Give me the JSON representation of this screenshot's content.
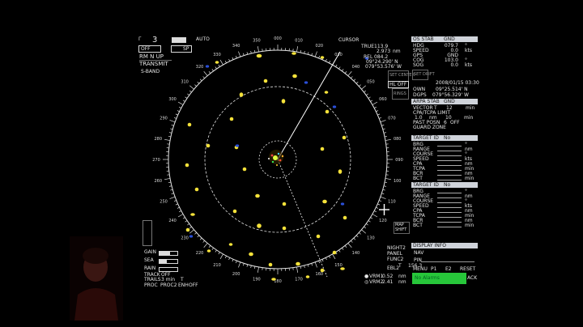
{
  "top_left": {
    "range_value": "3",
    "mode_off": "OFF",
    "sp_label": "SP",
    "auto_label": "AUTO",
    "orientation": "RM N UP",
    "transmit": "TRANSMIT",
    "band": "S-BAND"
  },
  "cursor": {
    "label": "CURSOR",
    "true_label": "TRUE",
    "true_value": "113.9",
    "rng_value": "2.973",
    "rng_unit": "nm",
    "rel_label": "REL",
    "rel_value": "084.2",
    "lat": "09°24.290' N",
    "lon": "079°53.576' W"
  },
  "side_buttons": {
    "set_center": "SET CENTER",
    "hl_off": "HL OFF",
    "rings": "RINGS"
  },
  "ownship": {
    "header_left": "OS STAB",
    "header_right": "GND",
    "rows": [
      {
        "key": "HDG",
        "val": "079.7",
        "unit": "°"
      },
      {
        "key": "SPEED",
        "val": "0.0",
        "unit": "kts"
      },
      {
        "key": "GPS",
        "val": "GND",
        "unit": ""
      },
      {
        "key": "COG",
        "val": "103.0",
        "unit": "°"
      },
      {
        "key": "SOG",
        "val": "0.0",
        "unit": "kts"
      }
    ],
    "set_drift": "SET DRIFT",
    "datetime": "2008/01/15 03:30",
    "own_label": "OWN",
    "own_lat": "09°25.514' N",
    "dgps_label": "DGPS",
    "own_lon": "079°56.329' W"
  },
  "arpa": {
    "header_left": "ARPA STAB",
    "header_right": "GND",
    "vector_label": "VECTOR",
    "vector_t": "T",
    "vector_value": "12",
    "vector_unit": "min",
    "cpa_label": "CPA/TCPA LIMIT",
    "cpa_value": "1.0",
    "cpa_unit": "nm",
    "tcpa_value": "10",
    "tcpa_unit": "min",
    "past_posn": "PAST POSN",
    "past_value": "6",
    "past_state": "OFF",
    "guard_zone": "GUARD ZONE"
  },
  "target1": {
    "header_left": "TARGET ID",
    "header_right": "No",
    "rows": [
      {
        "key": "BRG",
        "unit": "°"
      },
      {
        "key": "RANGE",
        "unit": "nm"
      },
      {
        "key": "COURSE",
        "unit": "°"
      },
      {
        "key": "SPEED",
        "unit": "kts"
      },
      {
        "key": "CPA",
        "unit": "nm"
      },
      {
        "key": "TCPA",
        "unit": "min"
      },
      {
        "key": "BCR",
        "unit": "nm"
      },
      {
        "key": "BCT",
        "unit": "min"
      }
    ]
  },
  "target2": {
    "header_left": "TARGET ID",
    "header_right": "No",
    "rows": [
      {
        "key": "BRG",
        "unit": "°"
      },
      {
        "key": "RANGE",
        "unit": "nm"
      },
      {
        "key": "COURSE",
        "unit": "°"
      },
      {
        "key": "SPEED",
        "unit": "kts"
      },
      {
        "key": "CPA",
        "unit": "nm"
      },
      {
        "key": "TCPA",
        "unit": "min"
      },
      {
        "key": "BCR",
        "unit": "nm"
      },
      {
        "key": "BCT",
        "unit": "min"
      }
    ]
  },
  "display_info": {
    "header": "DISPLAY INFO",
    "nav": "NAV",
    "pin": "PIN",
    "menu_items": [
      "MENU",
      "P1",
      "E2",
      "RESET"
    ],
    "alarm": "No Alarms",
    "ack": "ACK"
  },
  "bottom_left": {
    "gain": "GAIN",
    "sea": "SEA",
    "rain": "RAIN",
    "track_label": "TRACK",
    "track_value": "OFF",
    "trails_label": "TRAILS",
    "trails_value": "3 min",
    "trails_t": "T",
    "proc_label": "PROC",
    "proc_value": "PROC2",
    "enh_label": "ENH",
    "enh_value": "OFF"
  },
  "bottom_right": {
    "map_shift": "MAP SHIFT",
    "night": "NIGHT2",
    "panel": "PANEL",
    "func": "FUNC2",
    "ebl": "EBL2",
    "ebl_t": "T",
    "ebl_value": "156.3",
    "vrm1_label": "VRM1",
    "vrm1_value": "0.52",
    "vrm1_unit": "nm",
    "vrm2_label": "VRM2",
    "vrm2_value": "2.41",
    "vrm2_unit": "nm"
  },
  "bearing_ticks": [
    "000",
    "010",
    "020",
    "030",
    "040",
    "050",
    "060",
    "070",
    "080",
    "090",
    "100",
    "110",
    "120",
    "130",
    "140",
    "150",
    "160",
    "170",
    "180",
    "190",
    "200",
    "210",
    "220",
    "230",
    "240",
    "250",
    "260",
    "270",
    "280",
    "290",
    "300",
    "310",
    "320",
    "330",
    "340",
    "350"
  ],
  "colors": {
    "echo": "#f5e23a",
    "blue_echo": "#2a4fd8",
    "header": "#cfd3da",
    "alarm": "#27c63a"
  }
}
